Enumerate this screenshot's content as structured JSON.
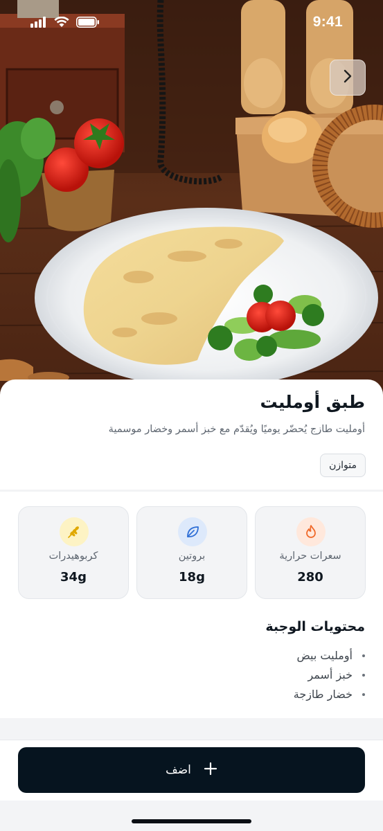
{
  "status_bar": {
    "time": "9:41",
    "icons": [
      "signal-icon",
      "wifi-icon",
      "battery-icon"
    ]
  },
  "hero": {
    "image_alt": "photo-of-omelette-plate",
    "next_icon": "chevron-right-icon"
  },
  "meal": {
    "title": "طبق أومليت",
    "description": "أومليت طازج يُحضّر يوميًا ويُقدّم مع خبز أسمر وخضار موسمية",
    "badge": "متوازن"
  },
  "nutrition": [
    {
      "key": "calories",
      "label": "سعرات حرارية",
      "value": "280",
      "icon": "flame-icon",
      "icon_color": "#f06a2b",
      "icon_bg": "#ffe8dc"
    },
    {
      "key": "protein",
      "label": "بروتين",
      "value": "18g",
      "icon": "leaf-icon",
      "icon_color": "#2f6fd6",
      "icon_bg": "#dde9fb"
    },
    {
      "key": "carbs",
      "label": "كربوهيدرات",
      "value": "34g",
      "icon": "wheat-icon",
      "icon_color": "#e0a800",
      "icon_bg": "#fdf3c4"
    }
  ],
  "contents": {
    "title": "محتويات الوجبة",
    "items": [
      "أومليت بيض",
      "خبز أسمر",
      "خضار طازجة"
    ]
  },
  "actions": {
    "add_label": "اضف",
    "add_icon": "plus-icon"
  },
  "colors": {
    "primary_button": "#06141f",
    "background_gray": "#f3f4f6"
  }
}
